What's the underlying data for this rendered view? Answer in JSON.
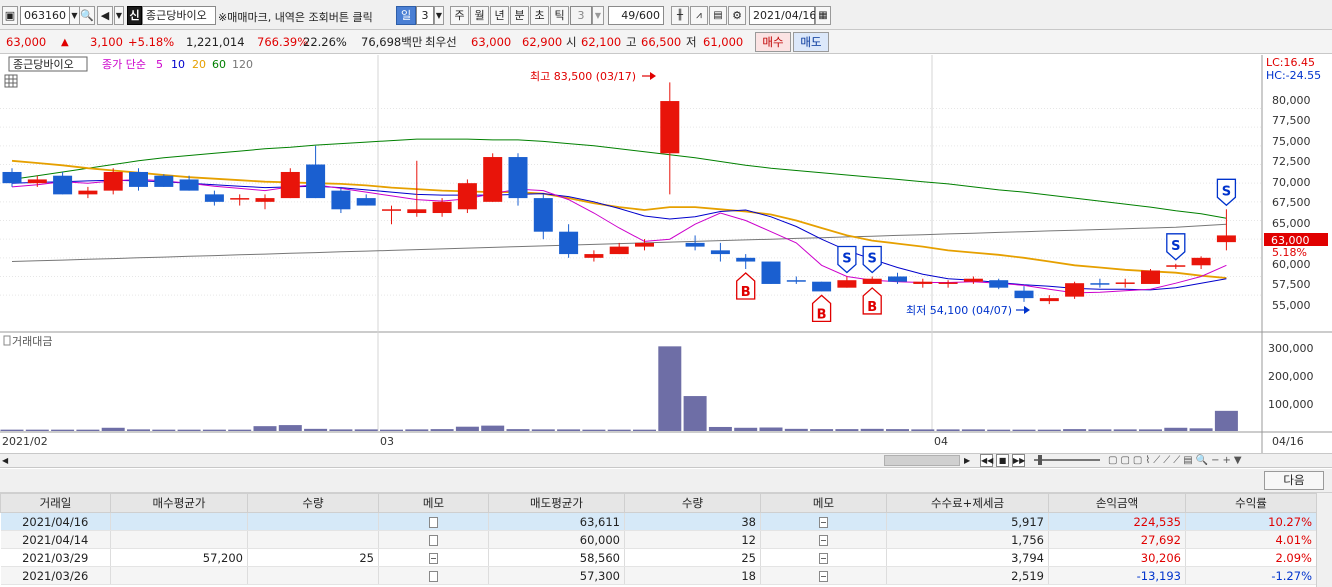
{
  "toolbar": {
    "code": "063160",
    "sin_label": "신",
    "name": "종근당바이오",
    "notice": "※매매마크, 내역은 조회버튼 클릭",
    "periods": [
      "일",
      "3",
      "주",
      "월",
      "년",
      "분",
      "초",
      "틱"
    ],
    "period_num": "3",
    "count": "49/600",
    "date": "2021/04/16"
  },
  "quote": {
    "price": "63,000",
    "change": "3,100",
    "change_pct": "+5.18%",
    "volume": "1,221,014",
    "vol_ratio": "766.39%",
    "turnover": "22.26%",
    "amount": "76,698백만",
    "best_label": "최우선",
    "best_ask": "63,000",
    "best_bid": "62,900",
    "open_label": "시",
    "open": "62,100",
    "high_label": "고",
    "high": "66,500",
    "low_label": "저",
    "low": "61,000",
    "buy_label": "매수",
    "sell_label": "매도"
  },
  "chart": {
    "stock_label": "종근당바이오",
    "ma_title": "종가 단순",
    "ma_periods": [
      {
        "label": "5",
        "color": "#cc00cc"
      },
      {
        "label": "10",
        "color": "#0000cc"
      },
      {
        "label": "20",
        "color": "#e6a000"
      },
      {
        "label": "60",
        "color": "#008000"
      },
      {
        "label": "120",
        "color": "#777777"
      }
    ],
    "lc_label": "LC:16.45",
    "hc_label": "HC:-24.55",
    "price_ticks": [
      "80,000",
      "77,500",
      "75,000",
      "72,500",
      "70,000",
      "67,500",
      "65,000",
      "62,500",
      "60,000",
      "57,500",
      "55,000"
    ],
    "price_tag": "63,000",
    "pct_tag": "5.18%",
    "high_annot": "최고 83,500 (03/17)",
    "low_annot": "최저 54,100 (04/07)",
    "volume_label": "거래대금",
    "volume_ticks": [
      "300,000",
      "200,000",
      "100,000"
    ],
    "date_ticks": [
      "2021/02",
      "03",
      "04"
    ],
    "last_date": "04/16"
  },
  "chart_data": {
    "type": "candlestick",
    "price_range": [
      51000,
      86500
    ],
    "candles": [
      [
        71500,
        72000,
        69500,
        70000
      ],
      [
        70000,
        71000,
        69500,
        70500
      ],
      [
        71000,
        71500,
        68500,
        68500
      ],
      [
        68500,
        69500,
        68000,
        69000
      ],
      [
        69000,
        72000,
        68500,
        71500
      ],
      [
        71500,
        72000,
        69000,
        69500
      ],
      [
        71000,
        71200,
        69500,
        69500
      ],
      [
        70500,
        71000,
        69000,
        69000
      ],
      [
        68500,
        69000,
        67000,
        67500
      ],
      [
        68000,
        68500,
        67000,
        68000
      ],
      [
        67500,
        68500,
        66500,
        68000
      ],
      [
        68000,
        72000,
        68000,
        71500
      ],
      [
        72500,
        75000,
        68000,
        68000
      ],
      [
        69000,
        69500,
        66000,
        66500
      ],
      [
        68000,
        68500,
        67000,
        67000
      ],
      [
        66500,
        67000,
        64500,
        66500
      ],
      [
        66000,
        73000,
        65500,
        66500
      ],
      [
        66000,
        68000,
        65500,
        67500
      ],
      [
        66500,
        70500,
        66000,
        70000
      ],
      [
        67500,
        74000,
        67500,
        73500
      ],
      [
        73500,
        74000,
        67000,
        68000
      ],
      [
        68000,
        68500,
        62500,
        63500
      ],
      [
        63500,
        64500,
        60000,
        60500
      ],
      [
        60000,
        61000,
        59500,
        60500
      ],
      [
        60500,
        62000,
        60500,
        61500
      ],
      [
        61500,
        62500,
        61000,
        62000
      ],
      [
        61500,
        64000,
        61500,
        64000
      ],
      [
        62000,
        63000,
        61000,
        61500
      ],
      [
        61000,
        62000,
        59500,
        60500
      ],
      [
        60000,
        60500,
        58500,
        59500
      ],
      [
        59500,
        59500,
        56500,
        56500
      ],
      [
        57000,
        57500,
        56500,
        56800
      ],
      [
        56800,
        56800,
        55500,
        55500
      ],
      [
        56000,
        57500,
        56000,
        57000
      ],
      [
        56500,
        57500,
        56500,
        57200
      ],
      [
        57500,
        58000,
        56500,
        56800
      ],
      [
        56500,
        57200,
        56000,
        56800
      ],
      [
        56500,
        57000,
        56000,
        56700
      ],
      [
        56800,
        57500,
        56500,
        57200
      ],
      [
        57000,
        57200,
        55800,
        56000
      ],
      [
        55600,
        56200,
        54100,
        54600
      ],
      [
        54200,
        55000,
        53800,
        54600
      ],
      [
        54800,
        56800,
        54500,
        56600
      ],
      [
        56600,
        57200,
        56000,
        56500
      ],
      [
        56500,
        57200,
        56000,
        56700
      ],
      [
        56500,
        58500,
        56500,
        58300
      ],
      [
        59000,
        59200,
        58500,
        59000
      ],
      [
        59000,
        60200,
        58500,
        60000
      ],
      [
        62100,
        66500,
        61000,
        63000
      ]
    ],
    "spike": {
      "index": 26,
      "open": 74000,
      "high": 83500,
      "low": 68500,
      "close": 81000
    },
    "ma5": [
      69500,
      69800,
      70200,
      70000,
      70300,
      70500,
      70300,
      70000,
      69600,
      69300,
      69000,
      69500,
      69800,
      69300,
      68800,
      68300,
      67800,
      67600,
      67900,
      68600,
      69200,
      69000,
      67800,
      66000,
      64000,
      62200,
      62500,
      64500,
      66000,
      65000,
      63500,
      62000,
      59000,
      57500,
      57000,
      56800,
      56700,
      56700,
      56800,
      56600,
      56300,
      55800,
      55300,
      55400,
      55600,
      55800,
      56600,
      57500,
      59000
    ],
    "ma10": [
      70000,
      70100,
      70200,
      70300,
      70400,
      70300,
      70200,
      70000,
      69800,
      69600,
      69400,
      69500,
      69600,
      69400,
      69100,
      68800,
      68500,
      68400,
      68400,
      68400,
      68500,
      68600,
      68200,
      67500,
      66600,
      65600,
      65200,
      65500,
      66200,
      66400,
      65500,
      64200,
      62500,
      61000,
      59800,
      58700,
      57800,
      57200,
      57000,
      56700,
      56400,
      56200,
      55900,
      55800,
      55800,
      55700,
      56000,
      56600,
      57200
    ],
    "ma20": [
      73000,
      72700,
      72400,
      72000,
      71700,
      71400,
      71100,
      70800,
      70600,
      70400,
      70200,
      70100,
      70000,
      69900,
      69700,
      69400,
      69200,
      69000,
      68900,
      68800,
      68800,
      68600,
      68000,
      67300,
      66800,
      66400,
      66800,
      66800,
      66500,
      66200,
      65800,
      65000,
      64000,
      63000,
      62300,
      61900,
      61500,
      61000,
      60700,
      60400,
      60000,
      59500,
      59000,
      58700,
      58400,
      58200,
      58000,
      57600,
      57300
    ],
    "ma60": [
      70500,
      71000,
      71500,
      72000,
      72500,
      73000,
      73400,
      73700,
      74000,
      74300,
      74600,
      74800,
      75100,
      75300,
      75500,
      75700,
      75900,
      75900,
      75900,
      75800,
      75800,
      75600,
      75300,
      75000,
      74600,
      74200,
      73800,
      73400,
      72900,
      72400,
      72000,
      71700,
      71400,
      71100,
      70800,
      70500,
      70200,
      69900,
      69500,
      69100,
      68800,
      68400,
      68000,
      67600,
      67200,
      66800,
      66300,
      65900,
      65300
    ],
    "ma120": [
      59500,
      59600,
      59700,
      59800,
      59900,
      60000,
      60100,
      60200,
      60300,
      60400,
      60500,
      60600,
      60700,
      60800,
      60900,
      61000,
      61100,
      61200,
      61300,
      61400,
      61500,
      61600,
      61700,
      61800,
      61900,
      62000,
      62100,
      62200,
      62300,
      62400,
      62500,
      62600,
      62700,
      62800,
      62900,
      63000,
      63100,
      63200,
      63300,
      63400,
      63500,
      63600,
      63700,
      63800,
      63900,
      64000,
      64100,
      64300,
      64500
    ],
    "volume_max": 320000,
    "volumes": [
      5000,
      5000,
      5000,
      5000,
      12000,
      6000,
      5000,
      5000,
      5000,
      5000,
      18000,
      22000,
      8000,
      6000,
      6000,
      5000,
      6000,
      7000,
      16000,
      20000,
      7000,
      6000,
      6000,
      5000,
      5000,
      5000,
      315000,
      130000,
      15000,
      12000,
      13000,
      8000,
      7000,
      7000,
      8000,
      7000,
      6000,
      6000,
      6000,
      5000,
      5000,
      5000,
      7000,
      6000,
      6000,
      6000,
      12000,
      10000,
      75000
    ],
    "markers": [
      {
        "type": "B",
        "index": 29,
        "pos": "below"
      },
      {
        "type": "B",
        "index": 32,
        "pos": "below"
      },
      {
        "type": "S",
        "index": 33,
        "pos": "above"
      },
      {
        "type": "B",
        "index": 34,
        "pos": "below"
      },
      {
        "type": "S",
        "index": 34,
        "pos": "above"
      },
      {
        "type": "S",
        "index": 46,
        "pos": "above"
      },
      {
        "type": "S",
        "index": 48,
        "pos": "above"
      }
    ]
  },
  "table": {
    "next_label": "다음",
    "headers": [
      "거래일",
      "매수평균가",
      "수량",
      "메모",
      "매도평균가",
      "수량",
      "메모",
      "수수료+제세금",
      "손익금액",
      "수익률"
    ],
    "rows": [
      {
        "date": "2021/04/16",
        "buy_avg": "",
        "buy_qty": "",
        "sell_avg": "63,611",
        "sell_qty": "38",
        "fee": "5,917",
        "pnl": "224,535",
        "ret": "10.27%",
        "sign": "pos"
      },
      {
        "date": "2021/04/14",
        "buy_avg": "",
        "buy_qty": "",
        "sell_avg": "60,000",
        "sell_qty": "12",
        "fee": "1,756",
        "pnl": "27,692",
        "ret": "4.01%",
        "sign": "pos"
      },
      {
        "date": "2021/03/29",
        "buy_avg": "57,200",
        "buy_qty": "25",
        "sell_avg": "58,560",
        "sell_qty": "25",
        "fee": "3,794",
        "pnl": "30,206",
        "ret": "2.09%",
        "sign": "pos"
      },
      {
        "date": "2021/03/26",
        "buy_avg": "",
        "buy_qty": "",
        "sell_avg": "57,300",
        "sell_qty": "18",
        "fee": "2,519",
        "pnl": "-13,193",
        "ret": "-1.27%",
        "sign": "neg"
      }
    ]
  }
}
